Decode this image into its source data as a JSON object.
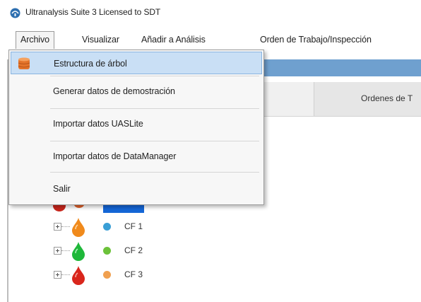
{
  "window": {
    "title": "Ultranalysis Suite 3 Licensed to SDT"
  },
  "menubar": {
    "items": [
      {
        "label": "Archivo",
        "active": true
      },
      {
        "label": "Visualizar"
      },
      {
        "label": "Añadir a Análisis"
      },
      {
        "label": "Orden de Trabajo/Inspección"
      }
    ]
  },
  "archivo_menu": {
    "items": [
      {
        "label": "Estructura de árbol",
        "icon": "database-icon",
        "highlighted": true
      },
      {
        "label": "Generar datos de demostración"
      },
      {
        "label": "Importar datos UASLite"
      },
      {
        "label": "Importar datos de DataManager"
      },
      {
        "label": "Salir"
      }
    ]
  },
  "tabs": {
    "ordenes_label": "Ordenes de T"
  },
  "tree": {
    "nodes": [
      {
        "label": "CF 1",
        "drop_color": "#f08a1c",
        "dot_color": "#3a9fd6"
      },
      {
        "label": "CF 2",
        "drop_color": "#1fb83a",
        "dot_color": "#6cc23a"
      },
      {
        "label": "CF 3",
        "drop_color": "#d9261c",
        "dot_color": "#f0a050"
      }
    ]
  },
  "colors": {
    "highlight": "#c9dff5",
    "toolbar_blue": "#6fa0cf",
    "selection_blue": "#1466d6"
  }
}
